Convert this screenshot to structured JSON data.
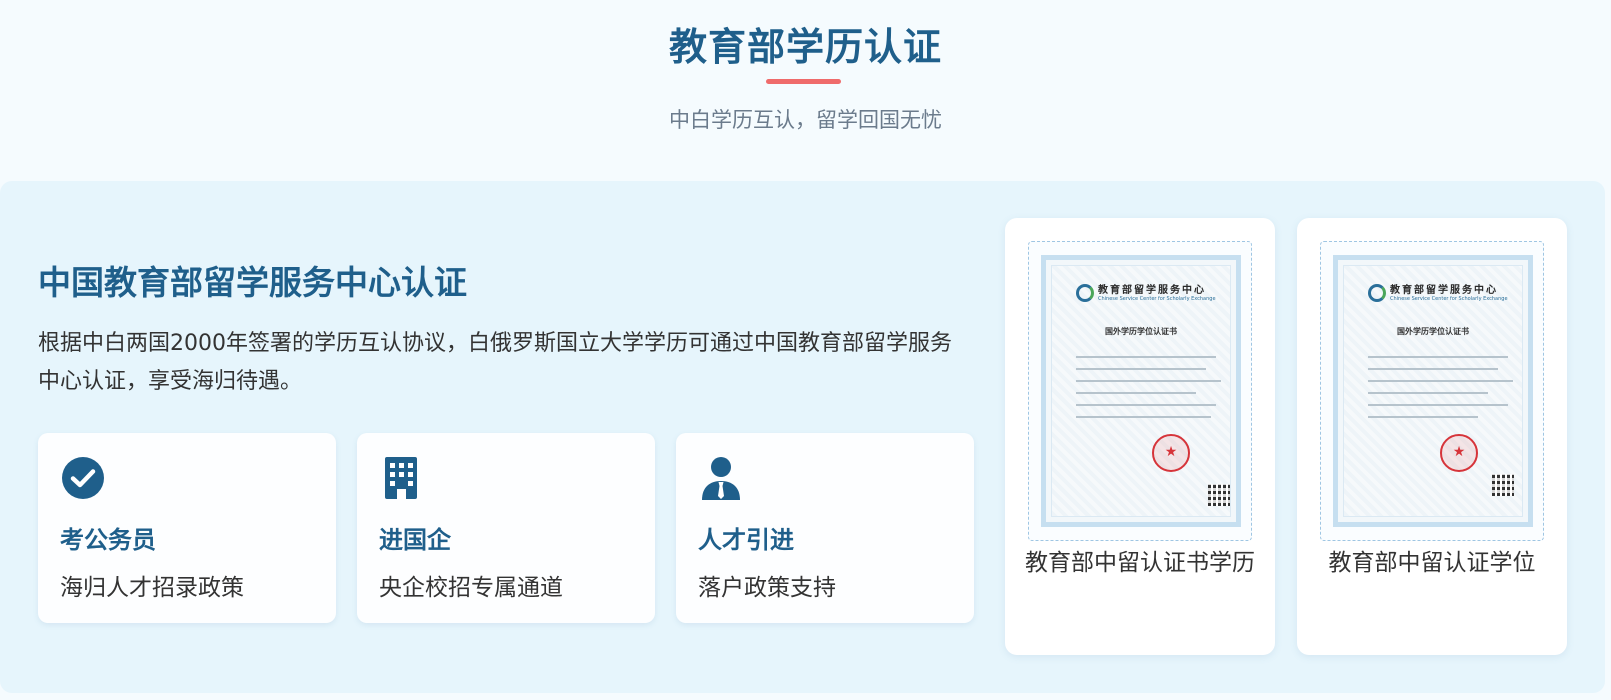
{
  "header": {
    "title": "教育部学历认证",
    "subtitle": "中白学历互认，留学回国无忧"
  },
  "section": {
    "title": "中国教育部留学服务中心认证",
    "description": "根据中白两国2000年签署的学历互认协议，白俄罗斯国立大学学历可通过中国教育部留学服务中心认证，享受海归待遇。"
  },
  "benefits": [
    {
      "icon": "check-circle-icon",
      "title": "考公务员",
      "subtitle": "海归人才招录政策"
    },
    {
      "icon": "building-icon",
      "title": "进国企",
      "subtitle": "央企校招专属通道"
    },
    {
      "icon": "person-tie-icon",
      "title": "人才引进",
      "subtitle": "落户政策支持"
    }
  ],
  "certificates": [
    {
      "caption": "教育部中留认证书学历",
      "doc_org": "教育部留学服务中心",
      "doc_org_en": "Chinese Service Center for Scholarly Exchange",
      "doc_heading": "国外学历学位认证书"
    },
    {
      "caption": "教育部中留认证学位",
      "doc_org": "教育部留学服务中心",
      "doc_org_en": "Chinese Service Center for Scholarly Exchange",
      "doc_heading": "国外学历学位认证书"
    }
  ],
  "colors": {
    "primary": "#1f5f8b",
    "accent": "#ef6b6b",
    "panel": "#e6f5fc"
  }
}
